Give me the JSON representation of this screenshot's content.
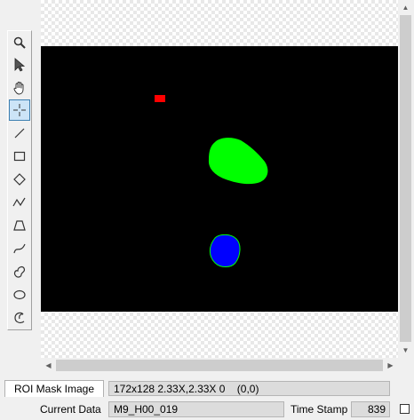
{
  "toolbar": {
    "tools": [
      {
        "name": "zoom-icon",
        "active": false
      },
      {
        "name": "pointer-arrow-icon",
        "active": false
      },
      {
        "name": "hand-pan-icon",
        "active": false
      },
      {
        "name": "crosshair-icon",
        "active": true
      },
      {
        "name": "line-tool-icon",
        "active": false
      },
      {
        "name": "rectangle-tool-icon",
        "active": false
      },
      {
        "name": "diamond-tool-icon",
        "active": false
      },
      {
        "name": "polyline-tool-icon",
        "active": false
      },
      {
        "name": "polygon-tool-icon",
        "active": false
      },
      {
        "name": "curve-tool-icon",
        "active": false
      },
      {
        "name": "closed-curve-tool-icon",
        "active": false
      },
      {
        "name": "ellipse-tool-icon",
        "active": false
      },
      {
        "name": "lasso-tool-icon",
        "active": false
      }
    ]
  },
  "image": {
    "background_color": "#000000",
    "roi_colors": {
      "red": "#ff0000",
      "green": "#00ff00",
      "blue": "#0000ff"
    }
  },
  "status": {
    "tab_label": "ROI Mask Image",
    "image_info": "172x128 2.33X,2.33X 0    (0,0)",
    "current_data_label": "Current Data",
    "current_data_value": "M9_H00_019",
    "time_stamp_label": "Time Stamp",
    "time_stamp_value": "839"
  }
}
